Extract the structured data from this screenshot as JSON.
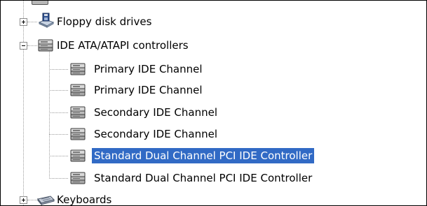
{
  "device_tree": {
    "floppy_disk_drives": {
      "label": "Floppy disk drives",
      "icon": "floppy-drive-icon",
      "expander": "collapsed"
    },
    "ide_controllers": {
      "label": "IDE ATA/ATAPI controllers",
      "icon": "ide-controller-icon",
      "expander": "expanded",
      "children": [
        {
          "label": "Primary IDE Channel",
          "icon": "ide-channel-icon",
          "selected": false
        },
        {
          "label": "Primary IDE Channel",
          "icon": "ide-channel-icon",
          "selected": false
        },
        {
          "label": "Secondary IDE Channel",
          "icon": "ide-channel-icon",
          "selected": false
        },
        {
          "label": "Secondary IDE Channel",
          "icon": "ide-channel-icon",
          "selected": false
        },
        {
          "label": "Standard Dual Channel PCI IDE Controller",
          "icon": "ide-channel-icon",
          "selected": true
        },
        {
          "label": "Standard Dual Channel PCI IDE Controller",
          "icon": "ide-channel-icon",
          "selected": false
        }
      ]
    },
    "keyboards": {
      "label": "Keyboards",
      "icon": "keyboard-icon",
      "expander": "collapsed"
    }
  },
  "colors": {
    "selection_background": "#316ac5",
    "selection_text": "#ffffff",
    "tree_lines": "#9d9d9d"
  }
}
